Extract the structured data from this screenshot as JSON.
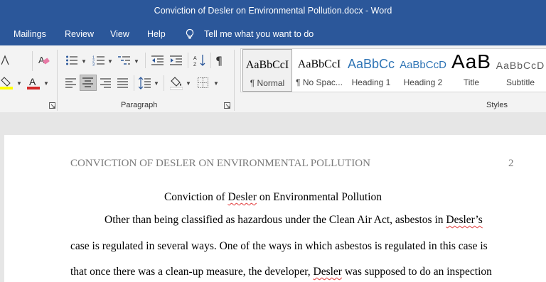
{
  "window": {
    "title": "Conviction of Desler on Environmental Pollution.docx  -  Word"
  },
  "menu": {
    "tabs": [
      "Mailings",
      "Review",
      "View",
      "Help"
    ],
    "tell_me": "Tell me what you want to do"
  },
  "ribbon": {
    "paragraph_label": "Paragraph",
    "styles_label": "Styles",
    "styles": [
      {
        "sample": "AaBbCcI",
        "name": "¶ Normal"
      },
      {
        "sample": "AaBbCcI",
        "name": "¶ No Spac..."
      },
      {
        "sample": "AaBbCc",
        "name": "Heading 1"
      },
      {
        "sample": "AaBbCcD",
        "name": "Heading 2"
      },
      {
        "sample": "AaB",
        "name": "Title"
      },
      {
        "sample": "AaBbCcD",
        "name": "Subtitle"
      }
    ]
  },
  "document": {
    "header": "CONVICTION OF DESLER ON ENVIRONMENTAL POLLUTION",
    "page_number": "2",
    "title_before": "Conviction of ",
    "title_word": "Desler",
    "title_after": " on Environmental Pollution",
    "line1_before": "Other than being classified as hazardous under the Clean Air Act, asbestos in ",
    "line1_word": "Desler’s",
    "line2": "case is regulated in several ways. One of the ways in which asbestos is regulated in this case is",
    "line3_before": "that once there was a clean-up measure, the developer, ",
    "line3_word": "Desler",
    "line3_after": " was supposed to do an inspection"
  },
  "colors": {
    "accent": "#2b579a",
    "ribbon": "#f3f3f3",
    "highlight": "#ffff00",
    "font_color": "#d42a2a"
  }
}
